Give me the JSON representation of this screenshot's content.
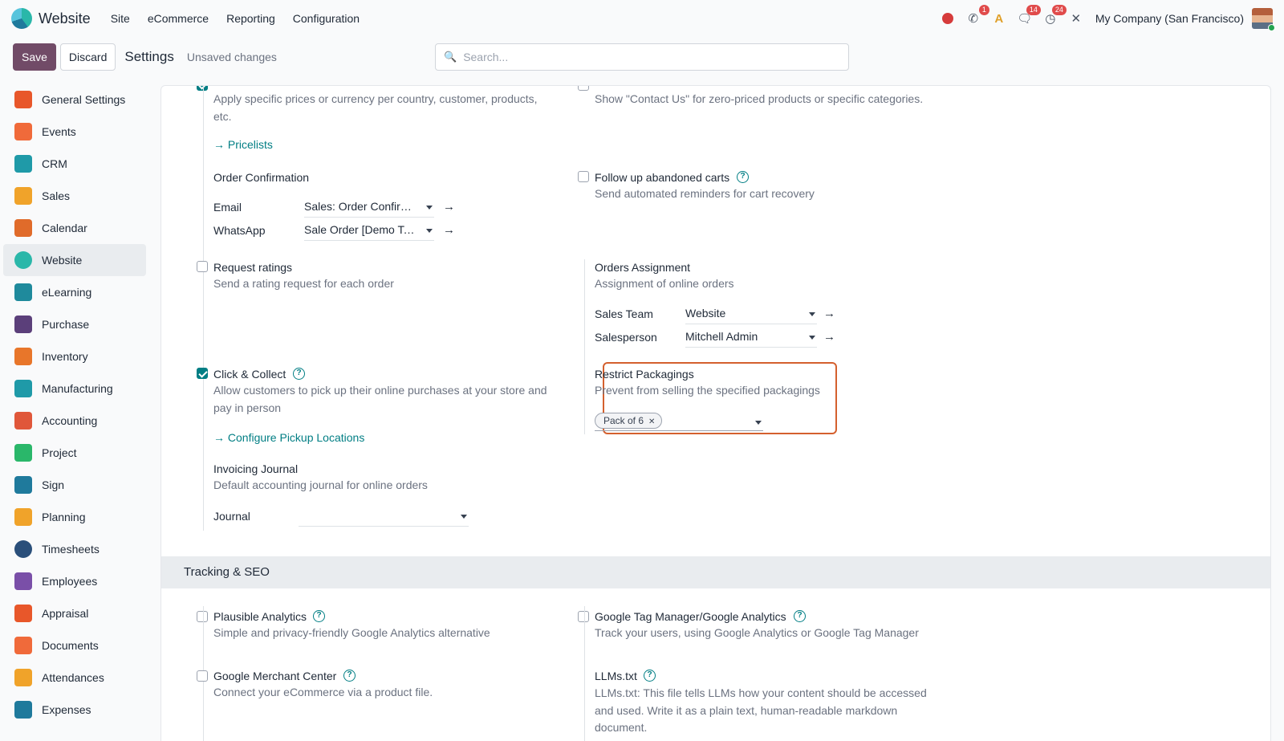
{
  "navbar": {
    "app_name": "Website",
    "menu": [
      "Site",
      "eCommerce",
      "Reporting",
      "Configuration"
    ],
    "badges": {
      "calls": "1",
      "messages": "14",
      "activities": "24"
    },
    "company": "My Company (San Francisco)"
  },
  "control": {
    "save_label": "Save",
    "discard_label": "Discard",
    "title": "Settings",
    "status": "Unsaved changes",
    "search_placeholder": "Search..."
  },
  "sidebar": {
    "active": "Website",
    "items": [
      {
        "label": "General Settings",
        "color": "#e8572a"
      },
      {
        "label": "Events",
        "color": "#f06a3a"
      },
      {
        "label": "CRM",
        "color": "#1f9aa8"
      },
      {
        "label": "Sales",
        "color": "#f0a32a"
      },
      {
        "label": "Calendar",
        "color": "#e06b2a"
      },
      {
        "label": "Website",
        "color": "#2ab7a9"
      },
      {
        "label": "eLearning",
        "color": "#1f8a9c"
      },
      {
        "label": "Purchase",
        "color": "#5b3f7a"
      },
      {
        "label": "Inventory",
        "color": "#e8762a"
      },
      {
        "label": "Manufacturing",
        "color": "#1f9aa8"
      },
      {
        "label": "Accounting",
        "color": "#e0573a"
      },
      {
        "label": "Project",
        "color": "#2ab76a"
      },
      {
        "label": "Sign",
        "color": "#1f7a9c"
      },
      {
        "label": "Planning",
        "color": "#f0a32a"
      },
      {
        "label": "Timesheets",
        "color": "#2a4f7a"
      },
      {
        "label": "Employees",
        "color": "#7a4fa8"
      },
      {
        "label": "Appraisal",
        "color": "#e8572a"
      },
      {
        "label": "Documents",
        "color": "#f06a3a"
      },
      {
        "label": "Attendances",
        "color": "#f0a32a"
      },
      {
        "label": "Expenses",
        "color": "#1f7a9c"
      }
    ]
  },
  "settings": {
    "pricelists": {
      "desc": "Apply specific prices or currency per country, customer, products, etc.",
      "link": "Pricelists"
    },
    "hide_add_to_cart": {
      "desc": "Show \"Contact Us\" for zero-priced products or specific categories."
    },
    "order_confirmation": {
      "title": "Order Confirmation",
      "email_label": "Email",
      "email_value": "Sales: Order Confirmation",
      "whatsapp_label": "WhatsApp",
      "whatsapp_value": "Sale Order [Demo Template]"
    },
    "abandoned_carts": {
      "title": "Follow up abandoned carts",
      "desc": "Send automated reminders for cart recovery"
    },
    "request_ratings": {
      "title": "Request ratings",
      "desc": "Send a rating request for each order"
    },
    "orders_assignment": {
      "title": "Orders Assignment",
      "desc": "Assignment of online orders",
      "team_label": "Sales Team",
      "team_value": "Website",
      "person_label": "Salesperson",
      "person_value": "Mitchell Admin"
    },
    "click_collect": {
      "title": "Click & Collect",
      "desc": "Allow customers to pick up their online purchases at your store and pay in person",
      "link": "Configure Pickup Locations"
    },
    "restrict_packagings": {
      "title": "Restrict Packagings",
      "desc": "Prevent from selling the specified packagings",
      "tag": "Pack of 6"
    },
    "invoicing_journal": {
      "title": "Invoicing Journal",
      "desc": "Default accounting journal for online orders",
      "journal_label": "Journal",
      "journal_value": ""
    }
  },
  "tracking": {
    "section_title": "Tracking & SEO",
    "plausible": {
      "title": "Plausible Analytics",
      "desc": "Simple and privacy-friendly Google Analytics alternative"
    },
    "gtm": {
      "title": "Google Tag Manager/Google Analytics",
      "desc": "Track your users, using Google Analytics or Google Tag Manager"
    },
    "merchant": {
      "title": "Google Merchant Center",
      "desc": "Connect your eCommerce via a product file."
    },
    "llms": {
      "title": "LLMs.txt",
      "desc": "LLMs.txt: This file tells LLMs how your content should be accessed and used. Write it as a plain text, human-readable markdown document."
    }
  }
}
